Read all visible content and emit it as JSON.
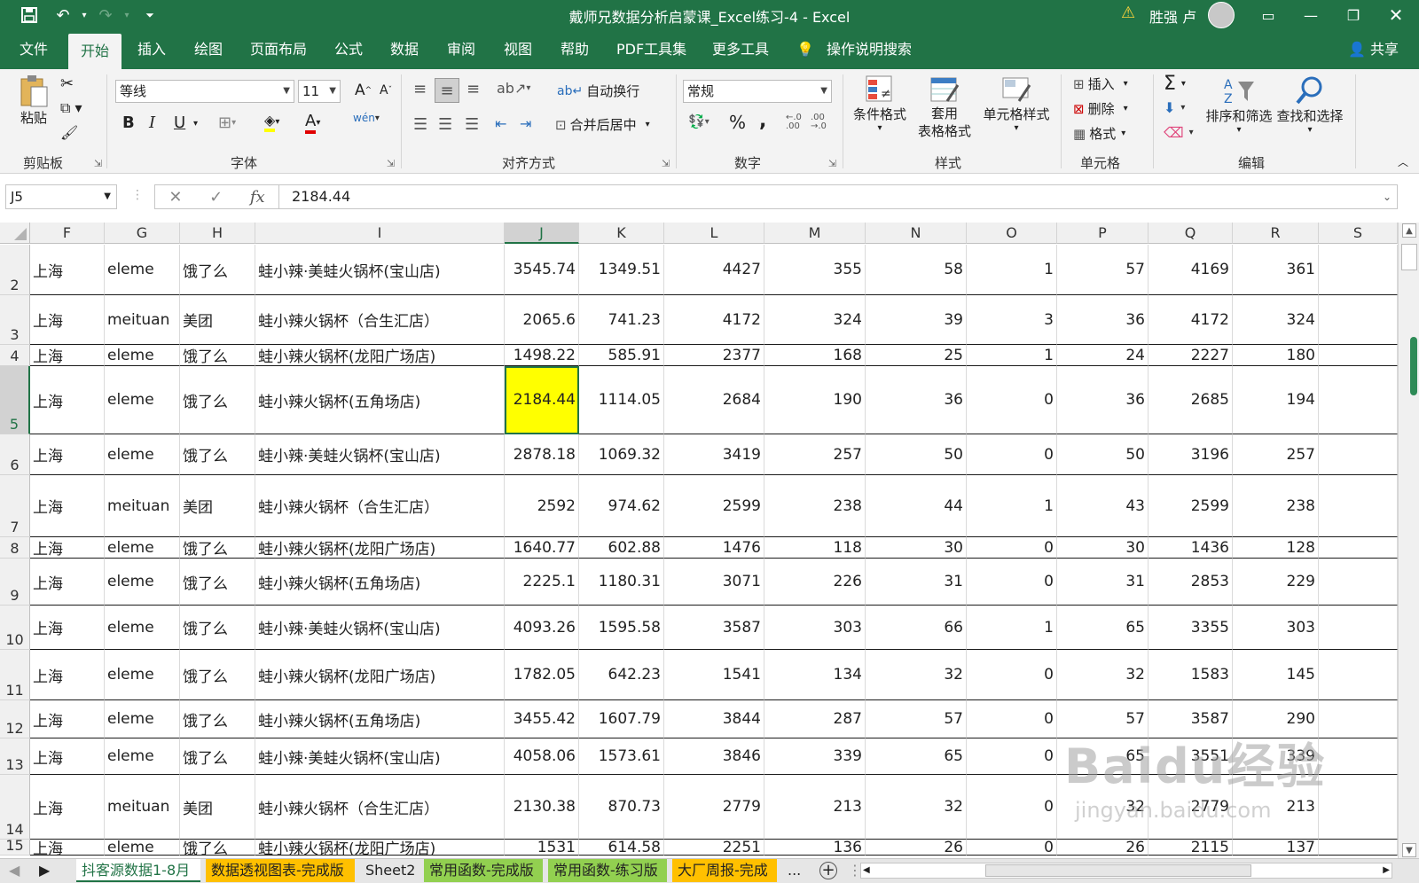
{
  "titlebar": {
    "title": "戴师兄数据分析启蒙课_Excel练习-4  -  Excel",
    "user": "胜强 卢",
    "save_icon": "floppy-icon",
    "undo_icon": "undo-icon"
  },
  "menu": {
    "tabs": [
      "文件",
      "开始",
      "插入",
      "绘图",
      "页面布局",
      "公式",
      "数据",
      "审阅",
      "视图",
      "帮助",
      "PDF工具集",
      "更多工具"
    ],
    "active": "开始",
    "search": "操作说明搜索",
    "share": "共享"
  },
  "ribbon": {
    "clipboard": {
      "label": "剪贴板",
      "paste": "粘贴"
    },
    "font": {
      "label": "字体",
      "name": "等线",
      "size": "11",
      "bold": "B",
      "italic": "I",
      "underline": "U",
      "grow": "A",
      "shrink": "A"
    },
    "align": {
      "label": "对齐方式",
      "wrap": "自动换行",
      "merge": "合并后居中"
    },
    "number": {
      "label": "数字",
      "format": "常规",
      "percent": "%",
      "comma": ","
    },
    "styles": {
      "label": "样式",
      "cond": "条件格式",
      "table1": "套用",
      "table2": "表格格式",
      "cell": "单元格样式"
    },
    "cells": {
      "label": "单元格",
      "insert": "插入",
      "delete": "删除",
      "format": "格式"
    },
    "edit": {
      "label": "编辑",
      "sort": "排序和筛选",
      "find": "查找和选择"
    }
  },
  "formula": {
    "namebox": "J5",
    "value": "2184.44"
  },
  "sheet": {
    "columns": [
      "F",
      "G",
      "H",
      "I",
      "J",
      "K",
      "L",
      "M",
      "N",
      "O",
      "P",
      "Q",
      "R",
      "S"
    ],
    "selected_col": "J",
    "selected_row": "5",
    "rows": [
      {
        "n": "2",
        "c": [
          "上海",
          "eleme",
          "饿了么",
          "蛙小辣·美蛙火锅杯(宝山店)",
          "3545.74",
          "1349.51",
          "4427",
          "355",
          "58",
          "1",
          "57",
          "4169",
          "361"
        ]
      },
      {
        "n": "3",
        "c": [
          "上海",
          "meituan",
          "美团",
          "蛙小辣火锅杯（合生汇店）",
          "2065.6",
          "741.23",
          "4172",
          "324",
          "39",
          "3",
          "36",
          "4172",
          "324"
        ]
      },
      {
        "n": "4",
        "c": [
          "上海",
          "eleme",
          "饿了么",
          "蛙小辣火锅杯(龙阳广场店)",
          "1498.22",
          "585.91",
          "2377",
          "168",
          "25",
          "1",
          "24",
          "2227",
          "180"
        ]
      },
      {
        "n": "5",
        "c": [
          "上海",
          "eleme",
          "饿了么",
          "蛙小辣火锅杯(五角场店)",
          "2184.44",
          "1114.05",
          "2684",
          "190",
          "36",
          "0",
          "36",
          "2685",
          "194"
        ]
      },
      {
        "n": "6",
        "c": [
          "上海",
          "eleme",
          "饿了么",
          "蛙小辣·美蛙火锅杯(宝山店)",
          "2878.18",
          "1069.32",
          "3419",
          "257",
          "50",
          "0",
          "50",
          "3196",
          "257"
        ]
      },
      {
        "n": "7",
        "c": [
          "上海",
          "meituan",
          "美团",
          "蛙小辣火锅杯（合生汇店）",
          "2592",
          "974.62",
          "2599",
          "238",
          "44",
          "1",
          "43",
          "2599",
          "238"
        ]
      },
      {
        "n": "8",
        "c": [
          "上海",
          "eleme",
          "饿了么",
          "蛙小辣火锅杯(龙阳广场店)",
          "1640.77",
          "602.88",
          "1476",
          "118",
          "30",
          "0",
          "30",
          "1436",
          "128"
        ]
      },
      {
        "n": "9",
        "c": [
          "上海",
          "eleme",
          "饿了么",
          "蛙小辣火锅杯(五角场店)",
          "2225.1",
          "1180.31",
          "3071",
          "226",
          "31",
          "0",
          "31",
          "2853",
          "229"
        ]
      },
      {
        "n": "10",
        "c": [
          "上海",
          "eleme",
          "饿了么",
          "蛙小辣·美蛙火锅杯(宝山店)",
          "4093.26",
          "1595.58",
          "3587",
          "303",
          "66",
          "1",
          "65",
          "3355",
          "303"
        ]
      },
      {
        "n": "11",
        "c": [
          "上海",
          "eleme",
          "饿了么",
          "蛙小辣火锅杯(龙阳广场店)",
          "1782.05",
          "642.23",
          "1541",
          "134",
          "32",
          "0",
          "32",
          "1583",
          "145"
        ]
      },
      {
        "n": "12",
        "c": [
          "上海",
          "eleme",
          "饿了么",
          "蛙小辣火锅杯(五角场店)",
          "3455.42",
          "1607.79",
          "3844",
          "287",
          "57",
          "0",
          "57",
          "3587",
          "290"
        ]
      },
      {
        "n": "13",
        "c": [
          "上海",
          "eleme",
          "饿了么",
          "蛙小辣·美蛙火锅杯(宝山店)",
          "4058.06",
          "1573.61",
          "3846",
          "339",
          "65",
          "0",
          "65",
          "3551",
          "339"
        ]
      },
      {
        "n": "14",
        "c": [
          "上海",
          "meituan",
          "美团",
          "蛙小辣火锅杯（合生汇店）",
          "2130.38",
          "870.73",
          "2779",
          "213",
          "32",
          "0",
          "32",
          "2779",
          "213"
        ]
      },
      {
        "n": "15",
        "c": [
          "上海",
          "eleme",
          "饿了么",
          "蛙小辣火锅杯(龙阳广场店)",
          "1531",
          "614.58",
          "2251",
          "136",
          "26",
          "0",
          "26",
          "2115",
          "137"
        ]
      }
    ]
  },
  "tabs": {
    "items": [
      {
        "label": "抖客源数据1-8月",
        "color": "#ffffff",
        "text": "#217346"
      },
      {
        "label": "数据透视图表-完成版",
        "color": "#ffc000",
        "text": "#222222"
      },
      {
        "label": "Sheet2",
        "color": "#e6e6e6",
        "text": "#222222"
      },
      {
        "label": "常用函数-完成版",
        "color": "#92d050",
        "text": "#222222"
      },
      {
        "label": "常用函数-练习版",
        "color": "#92d050",
        "text": "#222222"
      },
      {
        "label": "大厂周报-完成",
        "color": "#ffc000",
        "text": "#222222"
      }
    ],
    "more": "...",
    "add": "+"
  },
  "watermark": {
    "main": "Baidu经验",
    "sub": "jingyan.baidu.com"
  },
  "colors": {
    "brand": "#217346",
    "selected_cell": "#ffff00"
  }
}
